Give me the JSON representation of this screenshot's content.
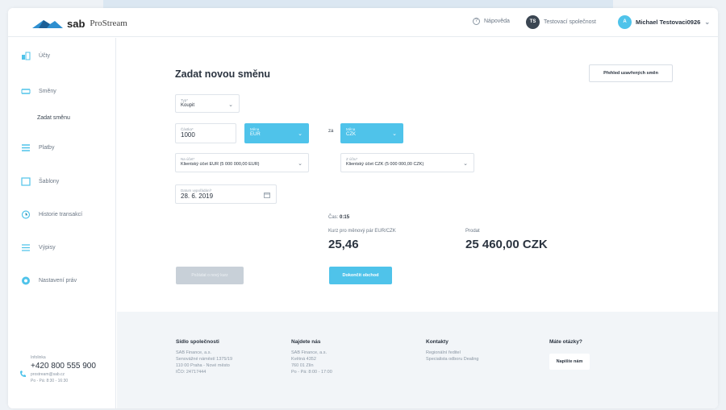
{
  "header": {
    "logo_sab": "sab",
    "logo_product": "ProStream",
    "help_label": "Nápověda",
    "company_badge": "TS",
    "company_name": "Testovací společnost",
    "user_badge": "A",
    "user_name": "Michael Testovaci0926"
  },
  "sidebar": {
    "items": [
      {
        "label": "Účty",
        "icon": "accounts-icon"
      },
      {
        "label": "Směny",
        "icon": "exchange-icon"
      },
      {
        "label": "Platby",
        "icon": "payments-icon"
      },
      {
        "label": "Šablony",
        "icon": "templates-icon"
      },
      {
        "label": "Historie transakcí",
        "icon": "history-icon"
      },
      {
        "label": "Výpisy",
        "icon": "statements-icon"
      },
      {
        "label": "Nastavení práv",
        "icon": "rights-icon"
      }
    ],
    "sub_item": "Zadat směnu",
    "contact": {
      "label": "Infolinka",
      "phone": "+420 800 555 900",
      "email": "prostream@sab.cz",
      "hours": "Po - Pá: 8:30 - 16:30"
    }
  },
  "main": {
    "title": "Zadat novou směnu",
    "overview_button": "Přehled uzavřených směn",
    "type_field": {
      "label": "Typ*",
      "value": "Koupit"
    },
    "amount_field": {
      "label": "Částka*",
      "value": "1000"
    },
    "currency_from": {
      "label": "Měna",
      "value": "EUR"
    },
    "za_label": "za",
    "currency_to": {
      "label": "Měna",
      "value": "CZK"
    },
    "account_from": {
      "label": "Na účet*",
      "value": "Klientský účet EUR (5 000 000,00 EUR)"
    },
    "account_to": {
      "label": "Z účtu*",
      "value": "Klientský účet CZK (5 000 000,00 CZK)"
    },
    "date_field": {
      "label": "Datum vypořádání*",
      "value": "28. 6. 2019"
    },
    "time_label": "Čas:",
    "time_value": "0:15",
    "rate_label": "Kurz pro měnový pár EUR/CZK",
    "rate_value": "25,46",
    "sell_label": "Prodat",
    "sell_value": "25 460,00 CZK",
    "disabled_button": "Požádat o nový kurz",
    "primary_button": "Dokončit obchod"
  },
  "footer": {
    "col1": {
      "title": "Sídlo společnosti",
      "lines": [
        "SAB Finance, a.s.",
        "Senovážné náměstí 1375/19",
        "110 00 Praha - Nové město",
        "IČO: 24717444"
      ]
    },
    "col2": {
      "title": "Najdete nás",
      "lines": [
        "SAB Finance, a.s.",
        "Květná 4352",
        "760 01 Zlín",
        "Po - Pá: 8:00 - 17:00"
      ]
    },
    "col3": {
      "title": "Kontakty",
      "lines": [
        "Regionální ředitel",
        "Specialista odboru Dealing"
      ]
    },
    "col4": {
      "title": "Máte otázky?",
      "button": "Napište nám"
    }
  },
  "colors": {
    "accent": "#4fc3ea",
    "text": "#2b3440",
    "muted": "#8a96a3"
  }
}
